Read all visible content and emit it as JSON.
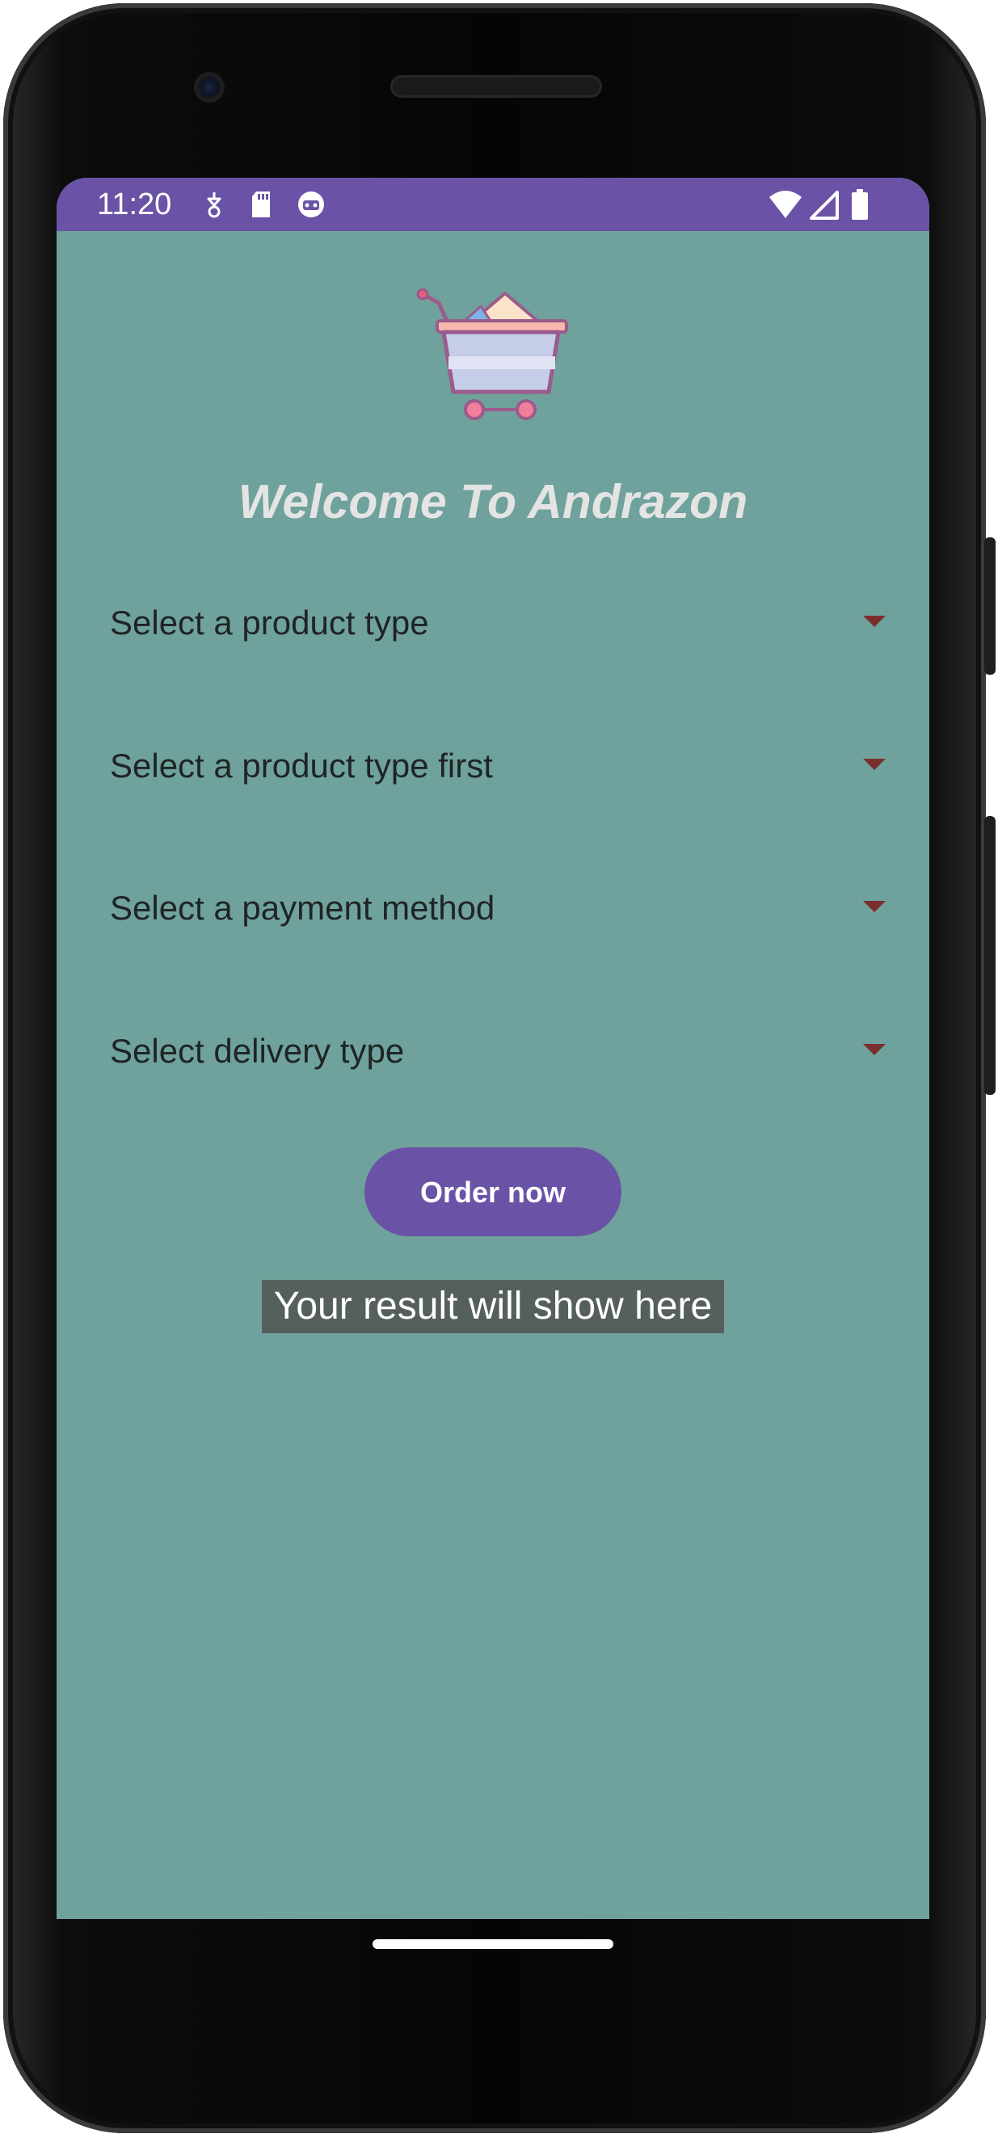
{
  "status_bar": {
    "time": "11:20",
    "left_icons": [
      "android-debug-icon",
      "sd-card-icon",
      "app-face-icon"
    ],
    "right_icons": [
      "wifi-icon",
      "cell-signal-icon",
      "battery-icon"
    ],
    "background_color": "#6a52a6"
  },
  "app": {
    "logo_icon": "shopping-cart-icon",
    "title": "Welcome To Andrazon",
    "background_color": "#6fa29c",
    "spinners": [
      {
        "label": "Select a product type"
      },
      {
        "label": "Select a product type first"
      },
      {
        "label": "Select a payment method"
      },
      {
        "label": "Select delivery type"
      }
    ],
    "order_button_label": "Order now",
    "result_text": "Your result will show here",
    "accent_color": "#6a52a6"
  }
}
